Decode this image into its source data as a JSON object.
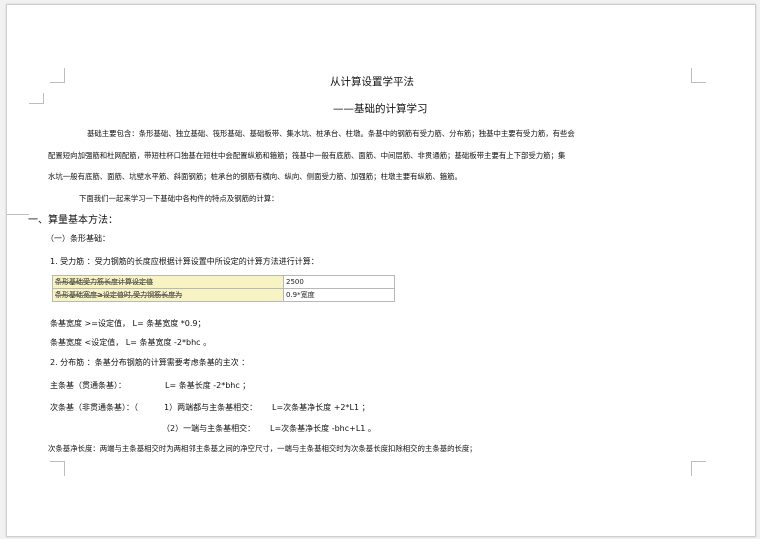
{
  "document": {
    "title": "从计算设置学平法",
    "subtitle": "——基础的计算学习",
    "intro": {
      "line1": "基础主要包含：条形基础、独立基础、筏形基础、基础板带、集水坑、桩承台、柱墩。条基中的钢筋有受力筋、分布筋；独基中主要有受力筋，有些会",
      "line2": "配置短向加强筋和杜网配筋，带短柱杯口独基在短柱中会配置纵筋和箍筋；筏基中一般有底筋、面筋、中间层筋、非贯通筋；基础板带主要有上下部受力筋；集",
      "line3": "水坑一般有底筋、面筋、坑壁水平筋、斜面钢筋；桩承台的钢筋有横向、纵向、侧面受力筋、加强筋；柱墩主要有纵筋、箍筋。",
      "line4": "下面我们一起来学习一下基础中各构件的特点及钢筋的计算："
    },
    "section1": "一、算量基本方法：",
    "sub1": "（一）条形基础：",
    "item1": "1. 受力筋 ：受力钢筋的长度应根据计算设置中所设定的计算方法进行计算：",
    "table": [
      {
        "label": "条形基础受力筋长度计算设定值",
        "value": "2500"
      },
      {
        "label": "条形基础宽度≥设定值时,受力钢筋长度为",
        "value": "0.9*宽度"
      }
    ],
    "rule1": "条基宽度 >=设定值， L= 条基宽度 *0.9；",
    "rule2": "条基宽度 <设定值， L= 条基宽度 -2*bhc 。",
    "item2": "2. 分布筋 ：条基分布钢筋的计算需要考虑条基的主次       ：",
    "main_label": "主条基（贯通条基）：",
    "main_formula": "L= 条基长度 -2*bhc ；",
    "sec_label": "次条基（非贯通条基）：（",
    "sec_case1": "1）两端都与主条基相交：",
    "sec_formula1": "L=次条基净长度  +2*L1 ；",
    "sec_case2": "（2）一端与主条基相交：",
    "sec_formula2": "L=次条基净长度  -bhc+L1 。",
    "last": "次条基净长度：两端与主条基相交时为两相邻主条基之间的净空尺寸，一端与主条基相交时为次条基长度扣除相交的主条基的长度；"
  }
}
